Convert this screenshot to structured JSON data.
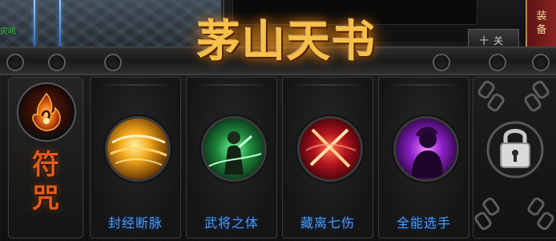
{
  "header": {
    "world_npc_tag": "灾峨",
    "side_button_label": "十关",
    "equip_tab_label_1": "装",
    "equip_tab_label_2": "备"
  },
  "title": "茅山天书",
  "category": {
    "label_line_1": "符",
    "label_line_2": "咒",
    "emblem_icon": "flame-sigil-icon"
  },
  "skills": [
    {
      "name": "封经断脉",
      "icon": "golden-vortex-icon",
      "accent": "#f0a020"
    },
    {
      "name": "武将之体",
      "icon": "green-warrior-icon",
      "accent": "#3fd06a"
    },
    {
      "name": "藏离七伤",
      "icon": "crimson-cross-slash-icon",
      "accent": "#d8283a"
    },
    {
      "name": "全能选手",
      "icon": "violet-shadow-figure-icon",
      "accent": "#b04ae8"
    }
  ],
  "locked_slot": {
    "icon": "padlock-icon"
  },
  "colors": {
    "title_gold": "#f7c04a",
    "skill_name_blue": "#4da2ff",
    "category_red": "#e35a1c"
  }
}
